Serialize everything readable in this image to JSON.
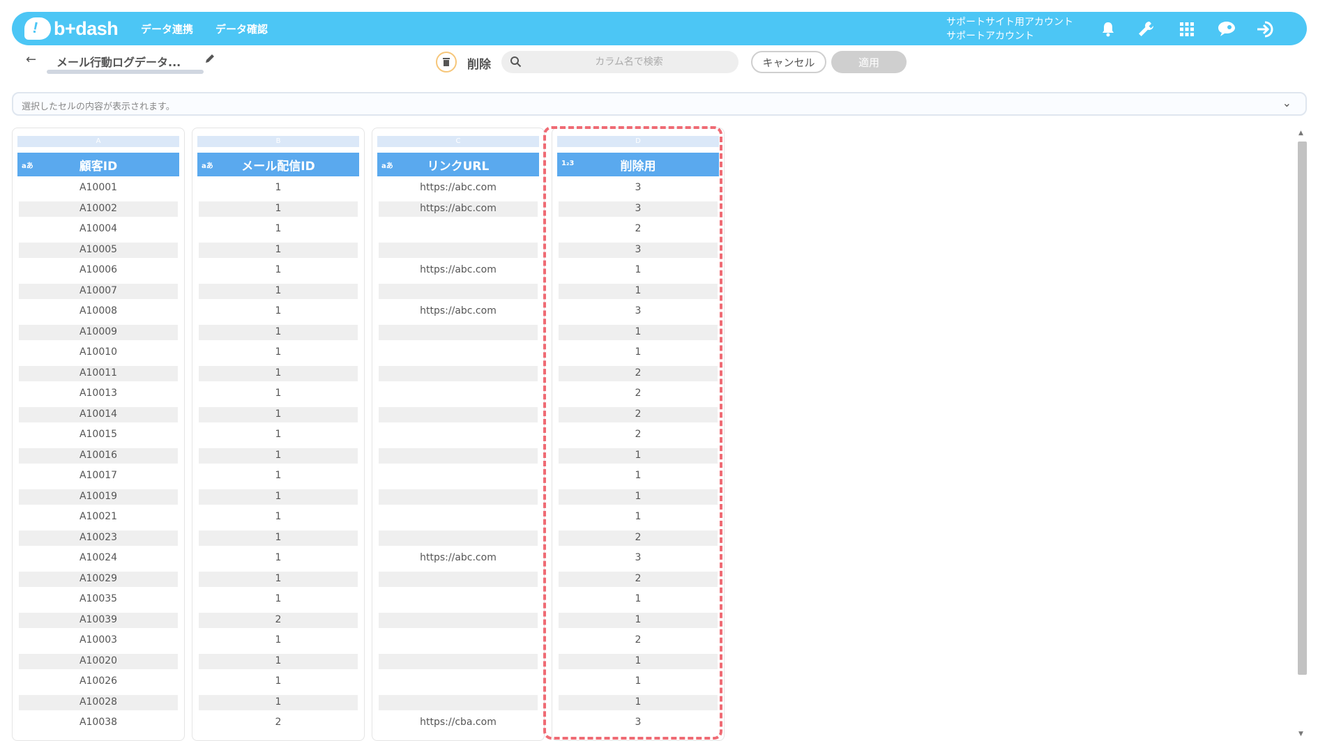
{
  "header": {
    "logo_text": "b+dash",
    "nav": [
      "データ連携",
      "データ確認"
    ],
    "account_line1": "サポートサイト用アカウント",
    "account_line2": "サポートアカウント"
  },
  "toolbar": {
    "title": "メール行動ログデータ...",
    "delete_label": "削除",
    "search_placeholder": "カラム名で検索",
    "cancel_label": "キャンセル",
    "apply_label": "適用"
  },
  "cell_display": {
    "text": "選択したセルの内容が表示されます。"
  },
  "columns": [
    {
      "letter": "A",
      "type": "aあ",
      "header": "顧客ID",
      "values": [
        "A10001",
        "A10002",
        "A10004",
        "A10005",
        "A10006",
        "A10007",
        "A10008",
        "A10009",
        "A10010",
        "A10011",
        "A10013",
        "A10014",
        "A10015",
        "A10016",
        "A10017",
        "A10019",
        "A10021",
        "A10023",
        "A10024",
        "A10029",
        "A10035",
        "A10039",
        "A10003",
        "A10020",
        "A10026",
        "A10028",
        "A10038"
      ]
    },
    {
      "letter": "B",
      "type": "aあ",
      "header": "メール配信ID",
      "values": [
        "1",
        "1",
        "1",
        "1",
        "1",
        "1",
        "1",
        "1",
        "1",
        "1",
        "1",
        "1",
        "1",
        "1",
        "1",
        "1",
        "1",
        "1",
        "1",
        "1",
        "1",
        "2",
        "1",
        "1",
        "1",
        "1",
        "2"
      ]
    },
    {
      "letter": "C",
      "type": "aあ",
      "header": "リンクURL",
      "values": [
        "https://abc.com",
        "https://abc.com",
        "",
        "",
        "https://abc.com",
        "",
        "https://abc.com",
        "",
        "",
        "",
        "",
        "",
        "",
        "",
        "",
        "",
        "",
        "",
        "https://abc.com",
        "",
        "",
        "",
        "",
        "",
        "",
        "",
        "https://cba.com"
      ]
    },
    {
      "letter": "D",
      "type": "1₂3",
      "header": "削除用",
      "values": [
        "3",
        "3",
        "2",
        "3",
        "1",
        "1",
        "3",
        "1",
        "1",
        "2",
        "2",
        "2",
        "2",
        "1",
        "1",
        "1",
        "1",
        "2",
        "3",
        "2",
        "1",
        "1",
        "2",
        "1",
        "1",
        "1",
        "3"
      ]
    }
  ]
}
